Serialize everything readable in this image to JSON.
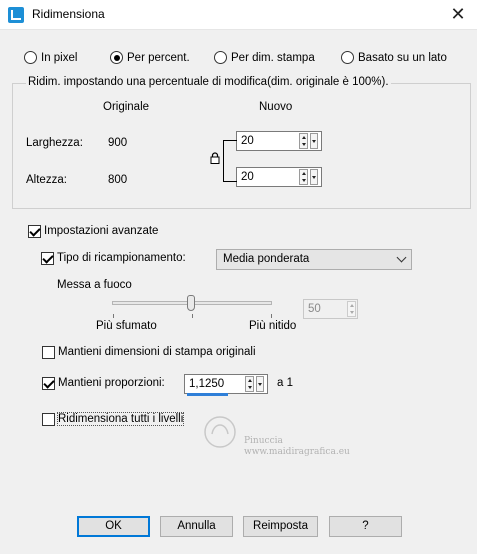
{
  "window": {
    "title": "Ridimensiona",
    "close_symbol": "✕"
  },
  "resize_mode": {
    "options": [
      "In pixel",
      "Per percent.",
      "Per dim. stampa",
      "Basato su un lato"
    ],
    "selected": "Per percent."
  },
  "percent_group": {
    "title": "Ridim. impostando una percentuale di modifica(dim. originale è 100%).",
    "col_original": "Originale",
    "col_new": "Nuovo",
    "width_label": "Larghezza:",
    "height_label": "Altezza:",
    "width_original": "900",
    "height_original": "800",
    "width_new": "20",
    "height_new": "20"
  },
  "advanced": {
    "label": "Impostazioni avanzate",
    "checked": true,
    "resample_label": "Tipo di ricampionamento:",
    "resample_checked": true,
    "resample_value": "Media ponderata",
    "sharpness_label": "Messa a fuoco",
    "sharpness_left": "Più sfumato",
    "sharpness_right": "Più nitido",
    "sharpness_value": "50",
    "keep_print_label": "Mantieni dimensioni di stampa originali",
    "keep_print_checked": false,
    "keep_ratio_label": "Mantieni proporzioni:",
    "keep_ratio_checked": true,
    "ratio_value": "1,1250",
    "ratio_suffix": "a 1",
    "all_layers_label": "Ridimensiona tutti i livelli",
    "all_layers_checked": false
  },
  "watermark": {
    "line1": "Pinuccia",
    "line2": "www.maidiragrafica.eu"
  },
  "buttons": {
    "ok": "OK",
    "cancel": "Annulla",
    "reset": "Reimposta",
    "help": "?"
  },
  "colors": {
    "accent": "#0078d7",
    "focus_underline": "#2f7fd8"
  }
}
